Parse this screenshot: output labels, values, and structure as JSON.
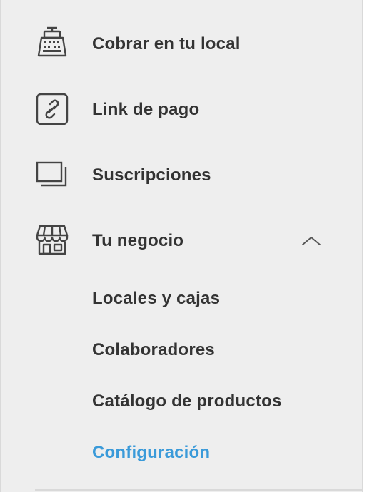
{
  "menu": {
    "items": [
      {
        "label": "Cobrar en tu local",
        "icon": "cash-register-icon"
      },
      {
        "label": "Link de pago",
        "icon": "link-icon"
      },
      {
        "label": "Suscripciones",
        "icon": "subscriptions-icon"
      },
      {
        "label": "Tu negocio",
        "icon": "storefront-icon",
        "expanded": true
      }
    ],
    "submenu": [
      {
        "label": "Locales y cajas",
        "active": false
      },
      {
        "label": "Colaboradores",
        "active": false
      },
      {
        "label": "Catálogo de productos",
        "active": false
      },
      {
        "label": "Configuración",
        "active": true
      }
    ]
  },
  "colors": {
    "background": "#eeeeee",
    "text": "#333333",
    "active": "#3a9ad9",
    "icon": "#444444"
  }
}
